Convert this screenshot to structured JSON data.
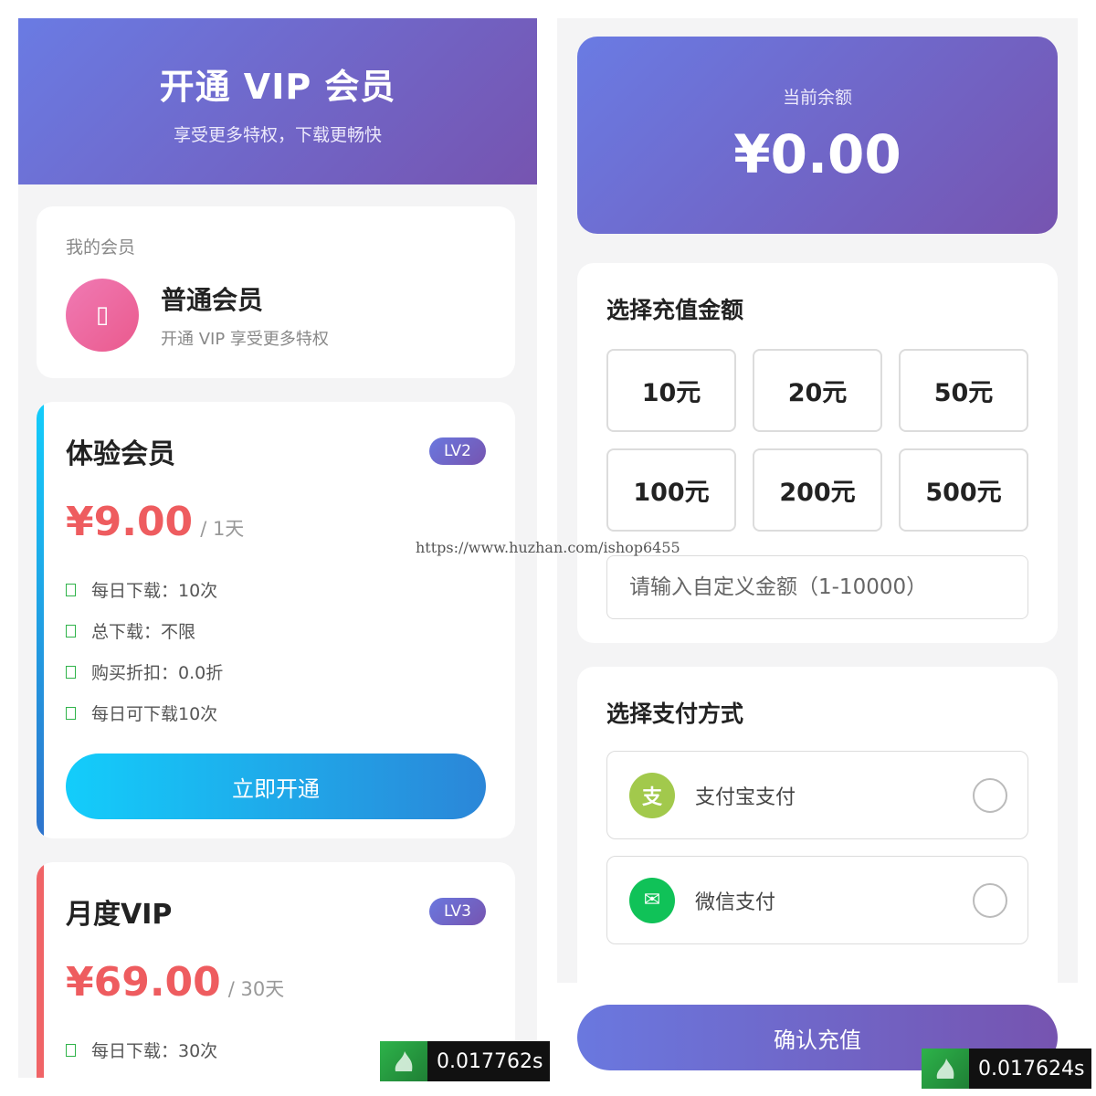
{
  "vip_page": {
    "hero": {
      "title": "开通 VIP 会员",
      "subtitle": "享受更多特权，下载更畅快"
    },
    "my_membership": {
      "label": "我的会员",
      "avatar_glyph": "▯",
      "level_name": "普通会员",
      "description": "开通 VIP 享受更多特权"
    },
    "plans": [
      {
        "name": "体验会员",
        "badge": "LV2",
        "price": "¥9.00",
        "period": "/ 1天",
        "features": [
          "每日下载：10次",
          "总下载：不限",
          "购买折扣：0.0折",
          "每日可下载10次"
        ],
        "button": "立即开通",
        "accent": "#13cdfb"
      },
      {
        "name": "月度VIP",
        "badge": "LV3",
        "price": "¥69.00",
        "period": "/ 30天",
        "features": [
          "每日下载：30次"
        ],
        "accent": "#f06467"
      }
    ]
  },
  "recharge_page": {
    "balance": {
      "label": "当前余额",
      "value": "¥0.00"
    },
    "amount_section": {
      "title": "选择充值金额",
      "options": [
        "10元",
        "20元",
        "50元",
        "100元",
        "200元",
        "500元"
      ],
      "custom_placeholder": "请输入自定义金额（1-10000）"
    },
    "payment_section": {
      "title": "选择支付方式",
      "methods": [
        {
          "name": "支付宝支付",
          "icon": "alipay-icon",
          "glyph": "支"
        },
        {
          "name": "微信支付",
          "icon": "wechat-icon",
          "glyph": "✉"
        }
      ]
    },
    "confirm_button": "确认充值"
  },
  "overlays": {
    "watermark": "https://www.huzhan.com/ishop6455",
    "timers": [
      "0.017762s",
      "0.017624s"
    ]
  },
  "colors": {
    "primary_gradient_start": "#6a7be3",
    "primary_gradient_end": "#7654b0",
    "price_red": "#ee5c5f",
    "check_green": "#2fb34a",
    "alipay_green": "#a2c94c",
    "wechat_green": "#10c258"
  }
}
